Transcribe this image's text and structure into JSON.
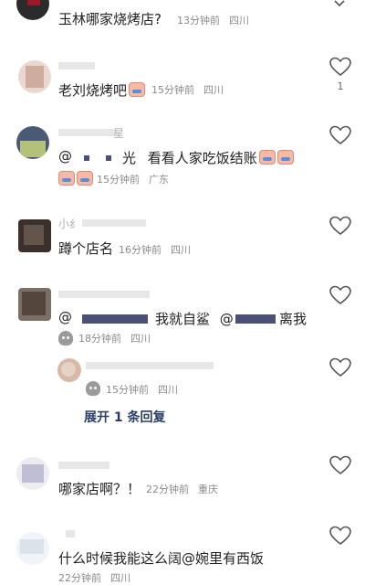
{
  "comments": [
    {
      "text": "玉林哪家烧烤店?",
      "time": "13分钟前",
      "location": "四川"
    },
    {
      "text": "老刘烧烤吧",
      "time": "15分钟前",
      "location": "四川",
      "likes": "1"
    },
    {
      "name_fragment": "星",
      "text_prefix": "@",
      "text_mid": "光",
      "text_main": "看看人家吃饭结账",
      "time": "15分钟前",
      "location": "广东"
    },
    {
      "name_fragment": "小纟",
      "text": "蹲个店名",
      "time": "16分钟前",
      "location": "四川"
    },
    {
      "text_prefix": "@",
      "text_mid": "我就自鲨",
      "text_mention": "@",
      "text_end": "离我",
      "time": "18分钟前",
      "location": "四川",
      "reply": {
        "time": "15分钟前",
        "location": "四川"
      }
    },
    {
      "text": "哪家店啊？！",
      "time": "22分钟前",
      "location": "重庆"
    },
    {
      "text": "什么时候我能这么阔@婉里有西饭",
      "time": "22分钟前",
      "location": "四川"
    }
  ],
  "expand_replies": "展开 1 条回复"
}
